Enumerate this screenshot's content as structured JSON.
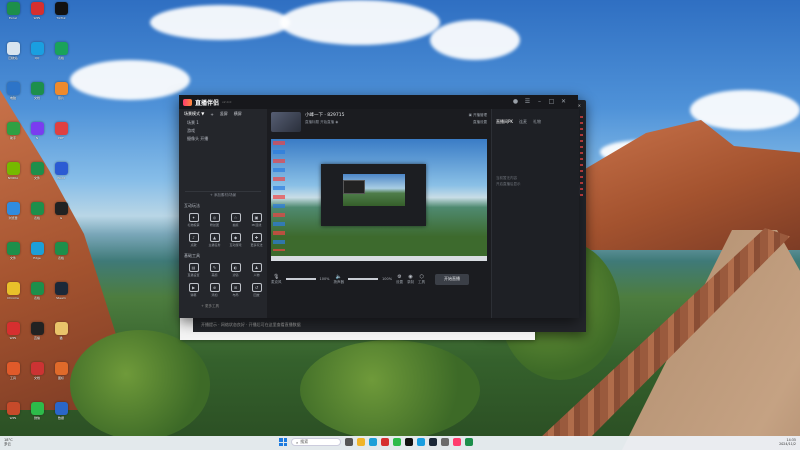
{
  "desktop": {
    "icons": [
      {
        "label": "Excel",
        "color": "#1d8f4b"
      },
      {
        "label": "WPS",
        "color": "#d62f2f"
      },
      {
        "label": "TikTok",
        "color": "#111111"
      },
      {
        "label": "回收站",
        "color": "#d8e4ef"
      },
      {
        "label": "QQ",
        "color": "#1a9fe0"
      },
      {
        "label": "表格",
        "color": "#1aa35a"
      },
      {
        "label": "电脑",
        "color": "#2d74c8"
      },
      {
        "label": "文档",
        "color": "#1d8f4b"
      },
      {
        "label": "照片",
        "color": "#ef8a2c"
      },
      {
        "label": "助手",
        "color": "#2fa043"
      },
      {
        "label": "N",
        "color": "#7a3cf0"
      },
      {
        "label": "PDF",
        "color": "#e04040"
      },
      {
        "label": "NVIDIA",
        "color": "#76b900"
      },
      {
        "label": "文件",
        "color": "#1d8f4b"
      },
      {
        "label": "Word",
        "color": "#2b5bd3"
      },
      {
        "label": "浏览器",
        "color": "#2f8ce0"
      },
      {
        "label": "表格",
        "color": "#1d8f4b"
      },
      {
        "label": "G",
        "color": "#222222"
      },
      {
        "label": "文件",
        "color": "#1d8f4b"
      },
      {
        "label": "Edge",
        "color": "#1c9fd8"
      },
      {
        "label": "表格",
        "color": "#1d8f4b"
      },
      {
        "label": "Chrome",
        "color": "#e8c02a"
      },
      {
        "label": "表格",
        "color": "#1d8f4b"
      },
      {
        "label": "Steam",
        "color": "#1b2838"
      },
      {
        "label": "WPS",
        "color": "#d62f2f"
      },
      {
        "label": "直播",
        "color": "#222222"
      },
      {
        "label": "猫",
        "color": "#e9c46a"
      },
      {
        "label": "工具",
        "color": "#e05a2a"
      },
      {
        "label": "文档",
        "color": "#c33"
      },
      {
        "label": "图标",
        "color": "#e06a2a"
      },
      {
        "label": "WPS",
        "color": "#c64a2a"
      },
      {
        "label": "微信",
        "color": "#2dbb4a"
      },
      {
        "label": "数据",
        "color": "#2a66c9"
      }
    ]
  },
  "app": {
    "logo": "直播伴侣",
    "version": "v2.0.0",
    "scene_header": [
      "场景模式 ▼",
      "+",
      "竖屏",
      "横屏"
    ],
    "scene_items": [
      "场景 1",
      "游戏",
      "摄像头 开播"
    ],
    "add_source": "+ 添加素材/场景",
    "section_interaction": "互动玩法",
    "section_tools": "基础工具",
    "interaction_tools": [
      {
        "icon": "✦",
        "label": "礼物投票"
      },
      {
        "icon": "◎",
        "label": "粉丝团"
      },
      {
        "icon": "☆",
        "label": "抽奖"
      },
      {
        "icon": "▣",
        "label": "PK连线"
      },
      {
        "icon": "♪",
        "label": "点歌"
      },
      {
        "icon": "▲",
        "label": "主播任务"
      },
      {
        "icon": "◆",
        "label": "互动游戏"
      },
      {
        "icon": "✚",
        "label": "更多玩法"
      }
    ],
    "basic_tools": [
      {
        "icon": "▤",
        "label": "直播设置"
      },
      {
        "icon": "✎",
        "label": "美颜"
      },
      {
        "icon": "◐",
        "label": "滤镜"
      },
      {
        "icon": "♟",
        "label": "人物"
      },
      {
        "icon": "▶",
        "label": "弹幕"
      },
      {
        "icon": "⊕",
        "label": "添加"
      },
      {
        "icon": "⊞",
        "label": "布局"
      },
      {
        "icon": "↺",
        "label": "回放"
      }
    ],
    "more_tools": "+ 更多工具",
    "stream_title": "小峰一下 · 829715",
    "stream_sub": "直播标题  开始直播 ◉",
    "header_links": [
      "▣ 开播管理",
      "直播设置"
    ],
    "controls": [
      {
        "icon": "🎙",
        "label": "麦克风",
        "pct": "100%",
        "fill": 1.0
      },
      {
        "icon": "🔈",
        "label": "扬声器",
        "pct": "100%",
        "fill": 1.0
      }
    ],
    "ctl_icons": [
      {
        "icon": "⚙",
        "label": "设置"
      },
      {
        "icon": "◉",
        "label": "录制"
      },
      {
        "icon": "⬡",
        "label": "工具"
      }
    ],
    "go_live": "开始直播",
    "right_tabs": [
      "直播间PK",
      "连麦",
      "礼物"
    ],
    "right_text": [
      "当前暂无内容",
      "开启直播后显示"
    ]
  },
  "side_window": {
    "title": "直播助手",
    "tabs": [
      "直播间PK",
      "连麦PK",
      "礼物"
    ],
    "muted": [
      "观众进入直播间后",
      "将显示互动消息"
    ],
    "notice": "欢迎来到直播间！请遵守直播规范，文明互动。"
  },
  "lower": {
    "text": "[推荐] 直播伴侣 · 新手教程  点击查看  |  更多内容",
    "bar_text": "开播提示 · 网络状态良好 · 开播后可在这里查看直播数据"
  },
  "taskbar": {
    "weather": "18°C\n多云",
    "search": "搜索",
    "apps": [
      {
        "label": "任务视图",
        "color": "#555"
      },
      {
        "label": "文件",
        "color": "#f0b429"
      },
      {
        "label": "浏览器",
        "color": "#1c9fd8"
      },
      {
        "label": "WPS",
        "color": "#d62f2f"
      },
      {
        "label": "微信",
        "color": "#2dbb4a"
      },
      {
        "label": "TikTok",
        "color": "#111"
      },
      {
        "label": "QQ",
        "color": "#1a9fe0"
      },
      {
        "label": "Steam",
        "color": "#1b2838"
      },
      {
        "label": "设置",
        "color": "#6b6b6b"
      },
      {
        "label": "直播",
        "color": "#ff3c6e"
      },
      {
        "label": "表格",
        "color": "#1d8f4b"
      }
    ],
    "clock": "14:35\n2024/11/2"
  }
}
